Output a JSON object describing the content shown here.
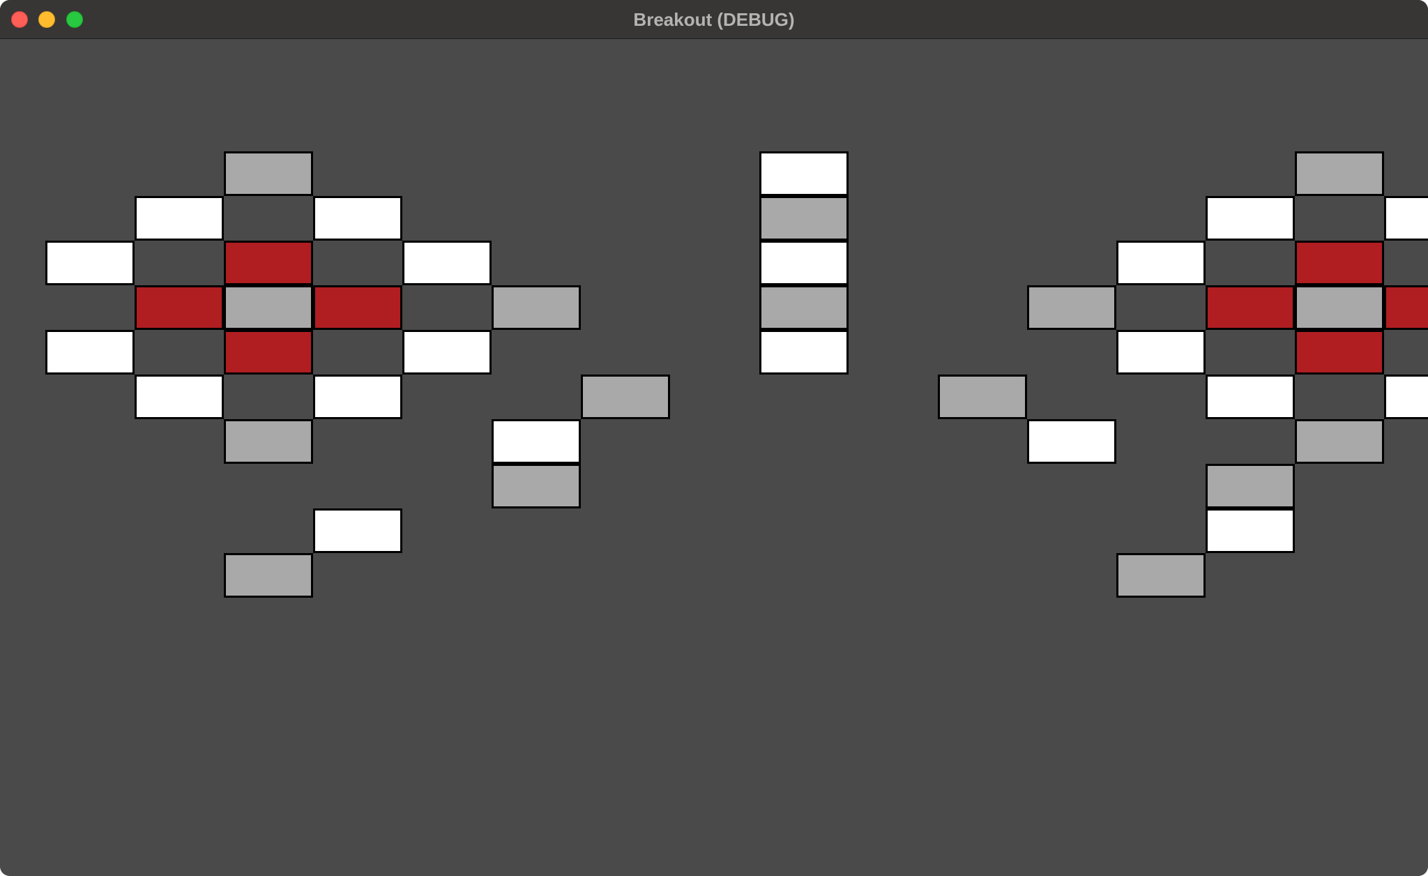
{
  "window": {
    "title": "Breakout (DEBUG)",
    "background": "#4a4a4a",
    "titlebar_background": "#383635",
    "title_color": "#b4b4b4",
    "traffic_lights": [
      {
        "name": "close",
        "color": "#ff5f57"
      },
      {
        "name": "minimize",
        "color": "#febc2e"
      },
      {
        "name": "zoom",
        "color": "#28c840"
      }
    ]
  },
  "brick_colors": {
    "white": "#ffffff",
    "gray": "#a9a9a9",
    "red": "#b01e22"
  },
  "level": {
    "columns": 15,
    "rows": 10,
    "grid": [
      "...G.....W.....G",
      "..W.W....G....W.W",
      ".W.R.W...W...W.R.W",
      "..RGR.G..G..G.RGR",
      ".W.R.W...W...W.R.W",
      "..W.W..G...G..W.W",
      "...G..W.....W..G",
      "......G.......G",
      "....W.........W",
      "...G.........G"
    ]
  }
}
